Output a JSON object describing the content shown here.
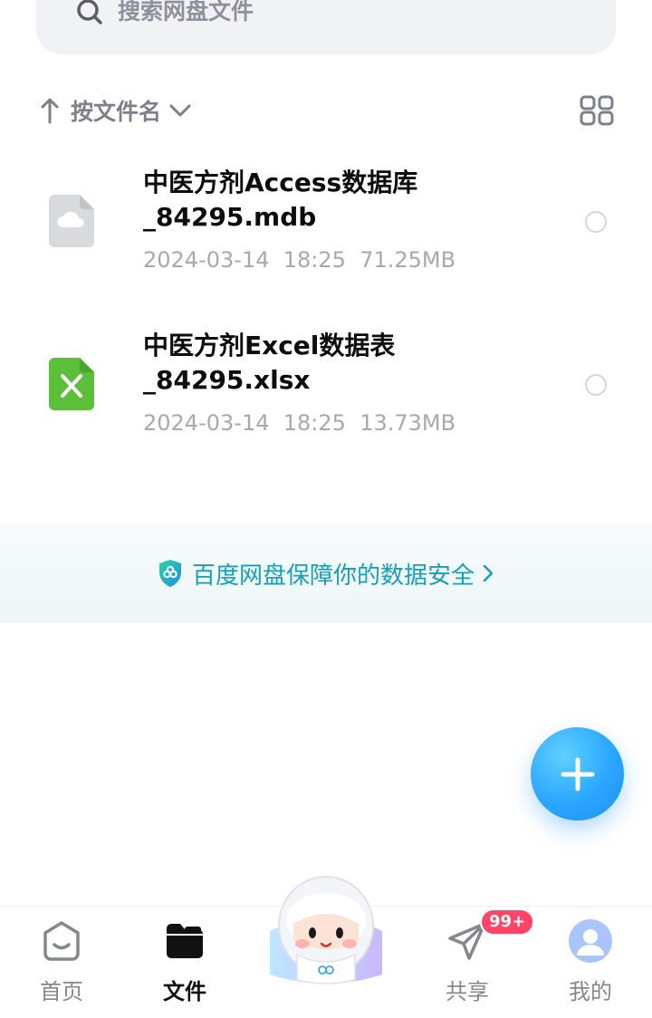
{
  "search": {
    "placeholder": "搜索网盘文件"
  },
  "sort": {
    "label": "按文件名"
  },
  "files": [
    {
      "name": "中医方剂Access数据库_84295.mdb",
      "date": "2024-03-14",
      "time": "18:25",
      "size": "71.25MB",
      "icon": "cloud-file-icon"
    },
    {
      "name": "中医方剂Excel数据表_84295.xlsx",
      "date": "2024-03-14",
      "time": "18:25",
      "size": "13.73MB",
      "icon": "excel-icon"
    }
  ],
  "security": {
    "text": "百度网盘保障你的数据安全"
  },
  "nav": {
    "home": "首页",
    "files": "文件",
    "share": "共享",
    "mine": "我的",
    "share_badge": "99+"
  },
  "colors": {
    "accent": "#2aa6ff",
    "security_text": "#16a0b8",
    "badge": "#ff4466",
    "excel_green": "#5cbf3a"
  }
}
